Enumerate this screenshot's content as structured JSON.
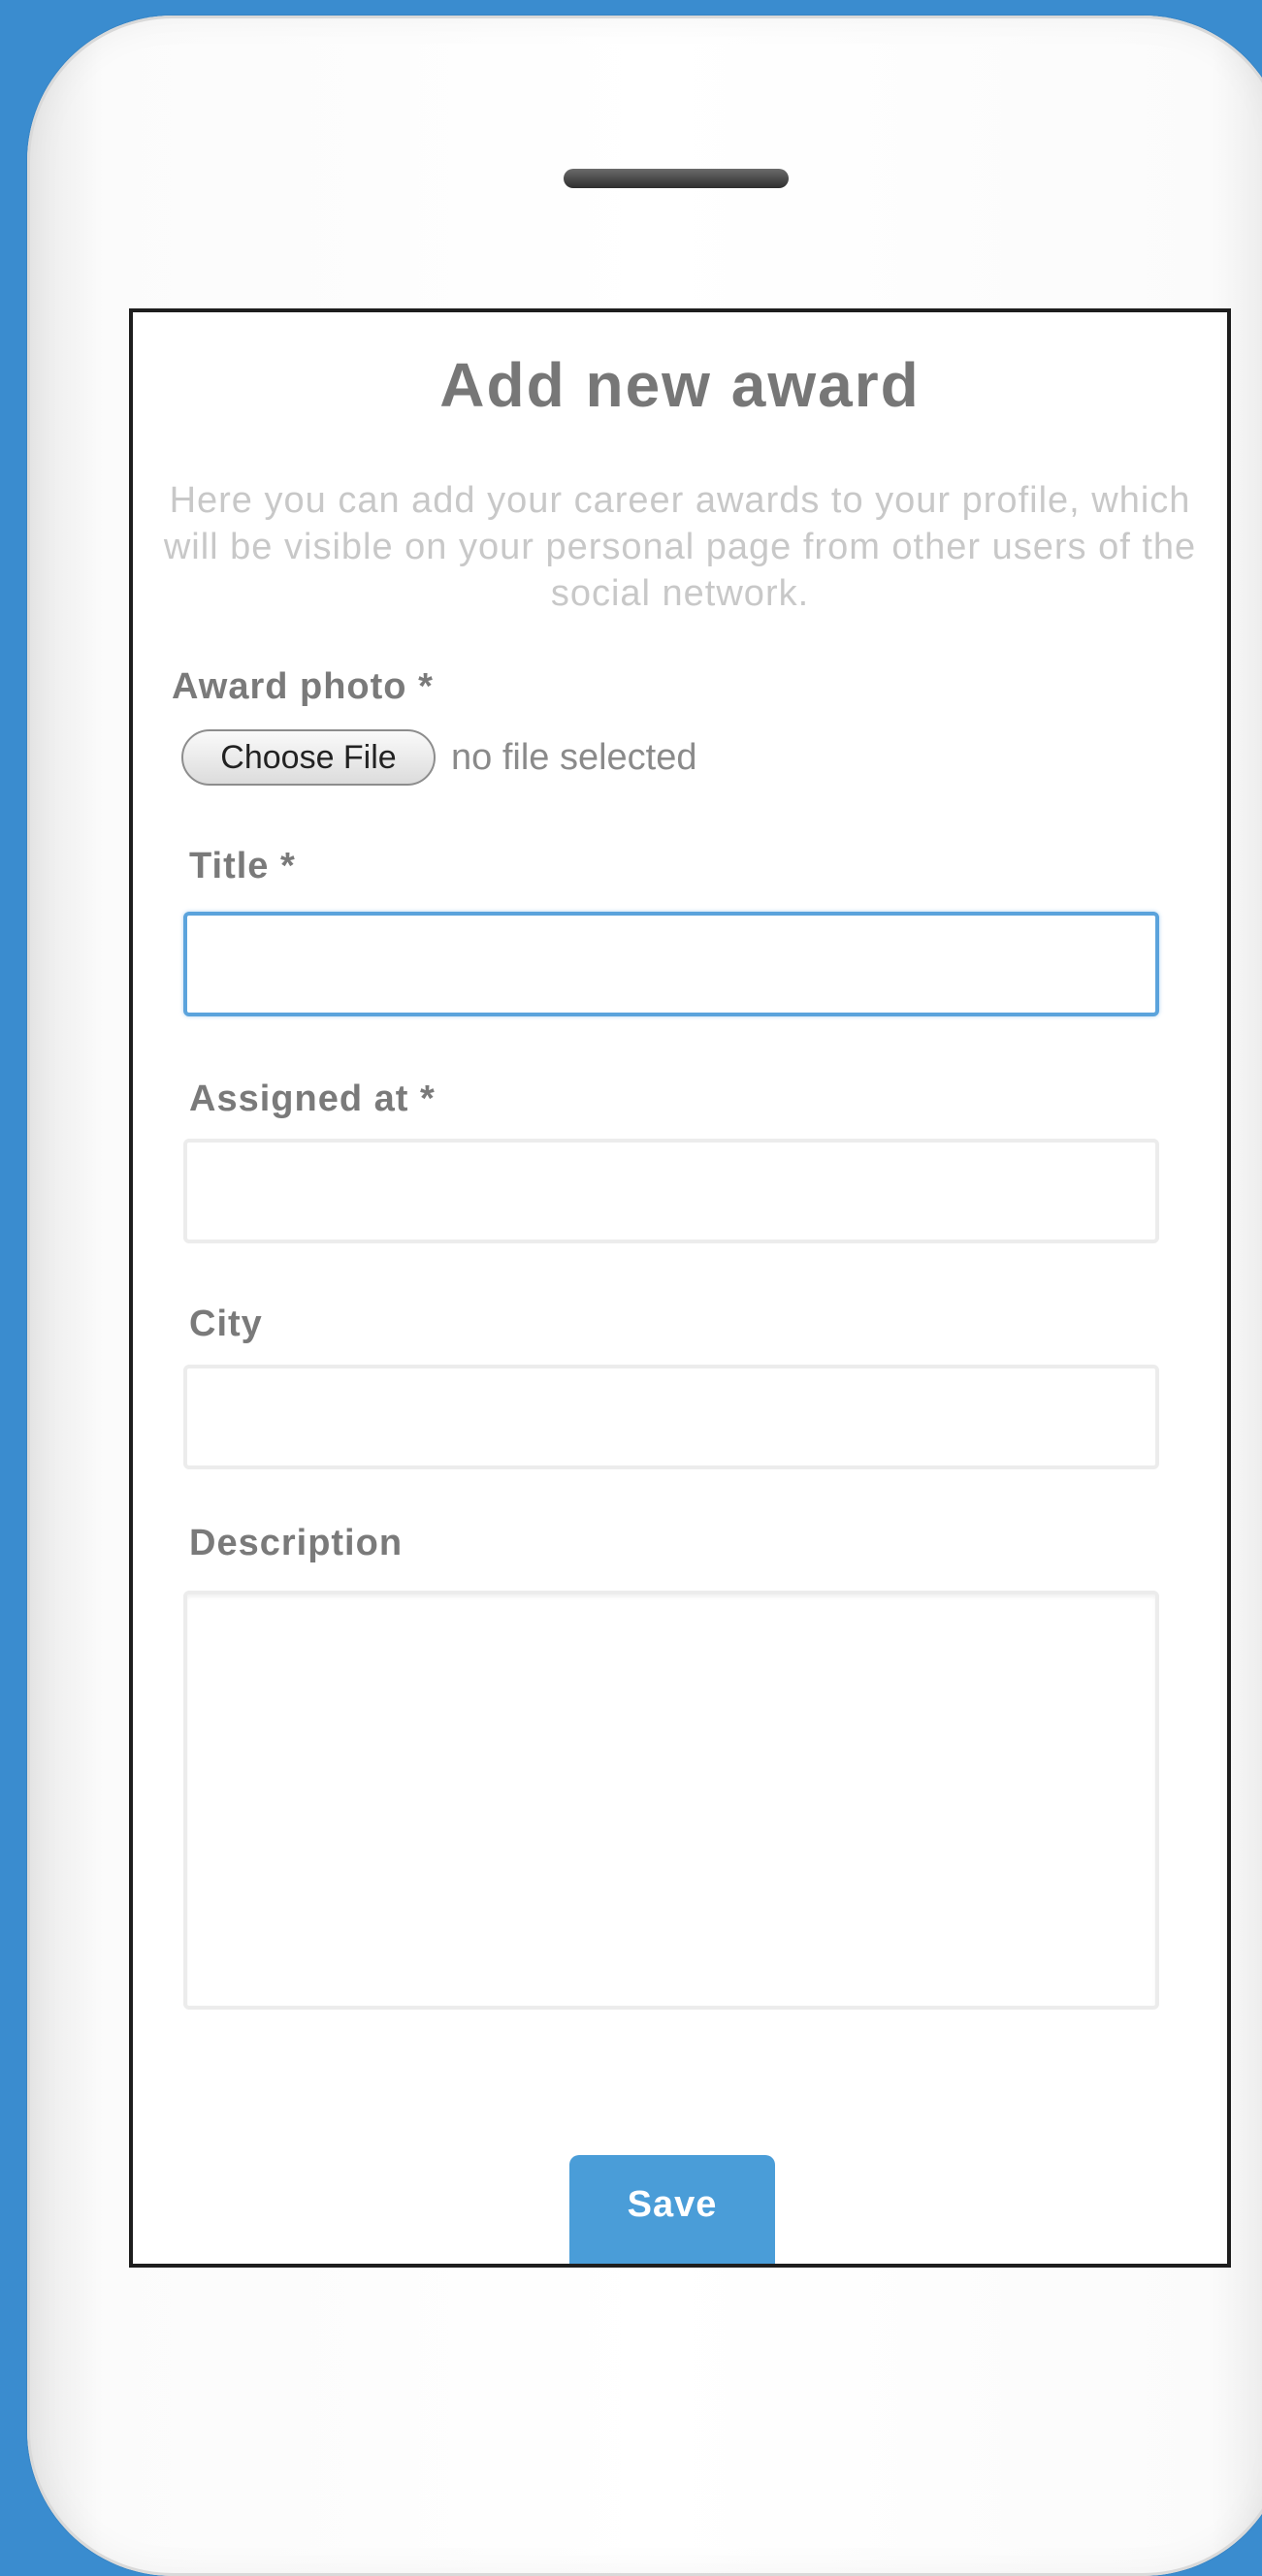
{
  "form": {
    "title": "Add new award",
    "description": "Here you can add your career awards to your profile, which will be visible on your personal page from other users of the social network.",
    "photo_label": "Award photo *",
    "file_button": "Choose File",
    "file_status": "no file selected",
    "title_label": "Title *",
    "title_value": "",
    "assigned_label": "Assigned at *",
    "assigned_value": "",
    "city_label": "City",
    "city_value": "",
    "description_label": "Description",
    "description_value": "",
    "save_label": "Save"
  },
  "colors": {
    "background": "#3a8ccf",
    "accent": "#4a9dd8",
    "focus_border": "#5ba3dc",
    "label_text": "#7a7a7a",
    "intro_text": "#c8c8c8"
  }
}
